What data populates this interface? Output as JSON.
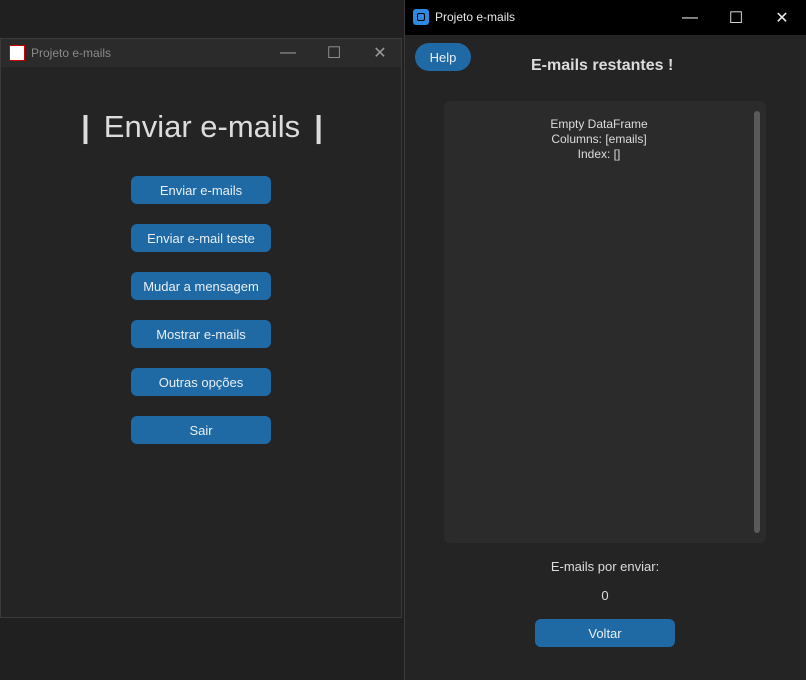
{
  "left_window": {
    "title": "Projeto e-mails",
    "heading": "Enviar e-mails",
    "buttons": {
      "send": "Enviar e-mails",
      "send_test": "Enviar e-mail teste",
      "change_message": "Mudar a mensagem",
      "show_emails": "Mostrar e-mails",
      "other_options": "Outras opções",
      "exit": "Sair"
    }
  },
  "right_window": {
    "title": "Projeto e-mails",
    "help_label": "Help",
    "panel_title": "E-mails restantes !",
    "dataframe_lines": [
      "Empty DataFrame",
      "Columns: [emails]",
      "Index: []"
    ],
    "remaining_label": "E-mails por enviar:",
    "remaining_count": "0",
    "back_label": "Voltar"
  },
  "colors": {
    "accent": "#1f6aa5",
    "background": "#242424",
    "text": "#dcdcdc"
  },
  "icons": {
    "minimize": "minimize-icon",
    "maximize": "maximize-icon",
    "close": "close-icon"
  }
}
